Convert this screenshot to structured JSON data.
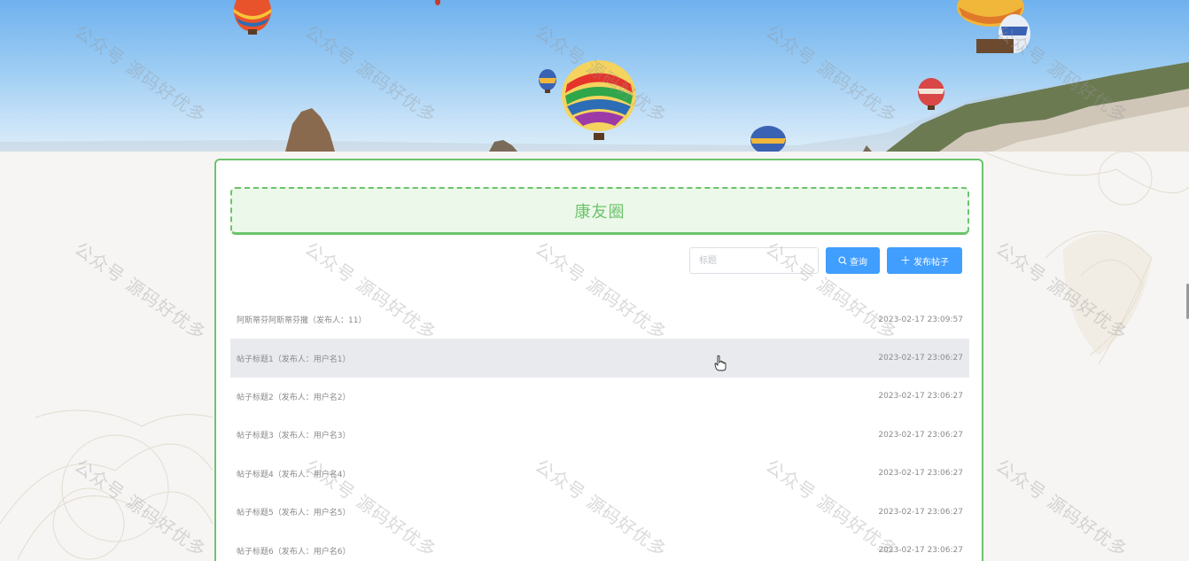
{
  "page": {
    "board_title": "康友圈",
    "watermark_text": "公众号 源码好优多"
  },
  "search": {
    "placeholder": "标题",
    "value": "",
    "search_button": "查询",
    "publish_button": "发布帖子",
    "search_icon": "search-icon",
    "publish_icon": "plus-icon"
  },
  "posts": [
    {
      "text": "阿斯蒂芬阿斯蒂芬撒（发布人：11）",
      "time": "2023-02-17 23:09:57"
    },
    {
      "text": "帖子标题1（发布人：用户名1）",
      "time": "2023-02-17 23:06:27"
    },
    {
      "text": "帖子标题2（发布人：用户名2）",
      "time": "2023-02-17 23:06:27"
    },
    {
      "text": "帖子标题3（发布人：用户名3）",
      "time": "2023-02-17 23:06:27"
    },
    {
      "text": "帖子标题4（发布人：用户名4）",
      "time": "2023-02-17 23:06:27"
    },
    {
      "text": "帖子标题5（发布人：用户名5）",
      "time": "2023-02-17 23:06:27"
    },
    {
      "text": "帖子标题6（发布人：用户名6）",
      "time": "2023-02-17 23:06:27"
    }
  ],
  "hovered_post_index": 1,
  "colors": {
    "accent_green": "#6cc36c",
    "title_bg": "#ecf8ea",
    "button_blue": "#409eff",
    "hover_row": "#e8eaee"
  }
}
